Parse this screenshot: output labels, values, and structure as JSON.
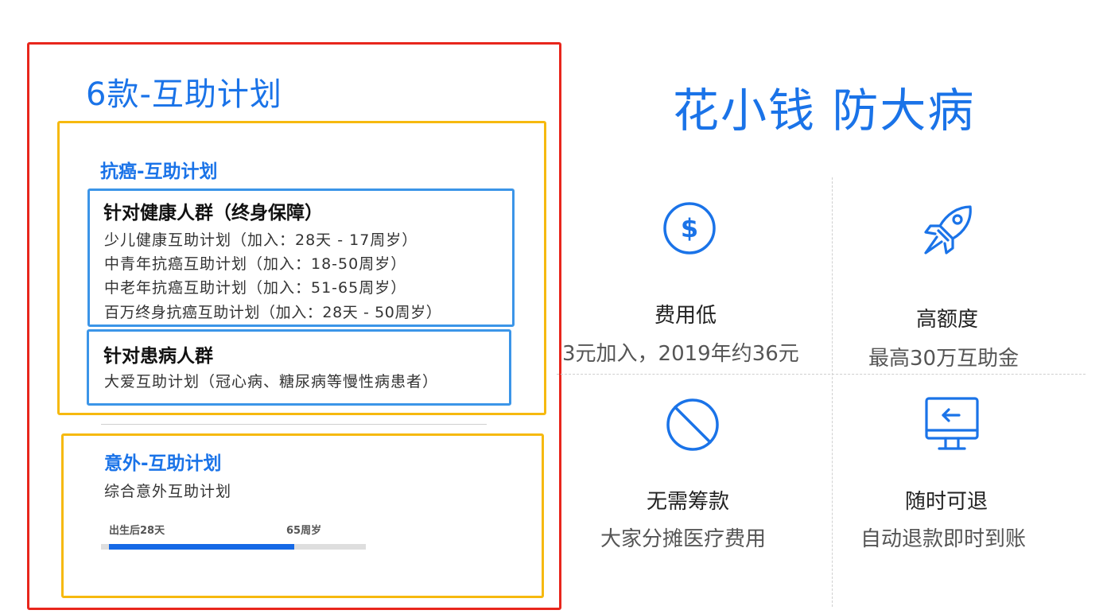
{
  "left": {
    "title": "6款-互助计划",
    "cancer": {
      "title": "抗癌-互助计划",
      "healthy": {
        "heading": "针对健康人群（终身保障）",
        "plans": [
          "少儿健康互助计划（加入：28天 - 17周岁）",
          "中青年抗癌互助计划（加入：18-50周岁）",
          "中老年抗癌互助计划（加入：51-65周岁）",
          "百万终身抗癌互助计划（加入：28天 - 50周岁）"
        ]
      },
      "patient": {
        "heading": "针对患病人群",
        "plans": [
          "大爱互助计划（冠心病、糖尿病等慢性病患者）"
        ]
      }
    },
    "accident": {
      "title": "意外-互助计划",
      "plan": "综合意外互助计划",
      "age_range": {
        "start_label": "出生后28天",
        "end_label": "65周岁",
        "fill_fraction": 0.72
      }
    }
  },
  "right": {
    "slogan": "花小钱 防大病",
    "features": [
      {
        "icon": "dollar-coin-icon",
        "title": "费用低",
        "desc": "3元加入，2019年约36元"
      },
      {
        "icon": "rocket-icon",
        "title": "高额度",
        "desc": "最高30万互助金"
      },
      {
        "icon": "no-entry-icon",
        "title": "无需筹款",
        "desc": "大家分摊医疗费用"
      },
      {
        "icon": "monitor-return-icon",
        "title": "随时可退",
        "desc": "自动退款即时到账"
      }
    ]
  },
  "colors": {
    "accent_blue": "#1a73e8",
    "frame_red": "#e8261c",
    "frame_yellow": "#f6b90f",
    "frame_blue": "#3b95e8",
    "bar_blue": "#1669e6"
  }
}
